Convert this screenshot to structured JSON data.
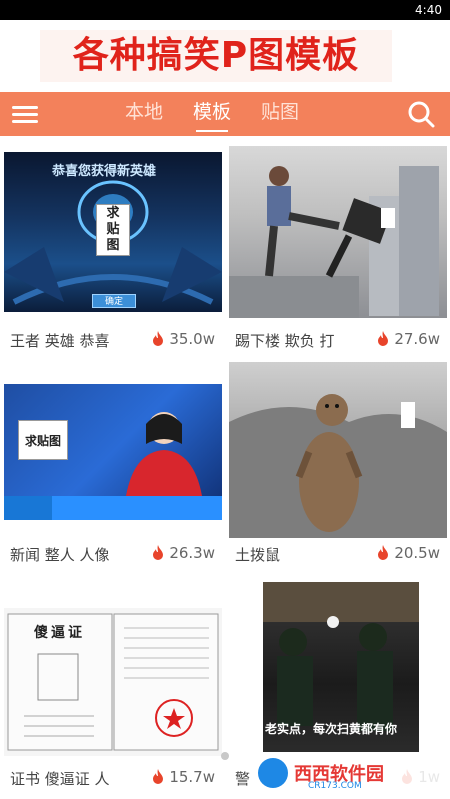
{
  "status_bar": {
    "time": "4:40"
  },
  "banner": {
    "title": "各种搞笑P图模板"
  },
  "navbar": {
    "tabs": [
      "本地",
      "模板",
      "贴图"
    ],
    "active_tab": "模板"
  },
  "templates": [
    {
      "tags": "王者 英雄 恭喜",
      "count": "35.0w",
      "overlay_title": "恭喜您获得新英雄",
      "paste_label": "求\n贴\n图",
      "button_label": "确定"
    },
    {
      "tags": "踢下楼 欺负 打",
      "count": "27.6w"
    },
    {
      "tags": "新闻 整人 人像",
      "count": "26.3w",
      "paste_label": "求贴图"
    },
    {
      "tags": "土拨鼠",
      "count": "20.5w"
    },
    {
      "tags": "证书 傻逼证 人",
      "count": "15.7w",
      "cert_title": "傻逼证"
    },
    {
      "tags": "警",
      "count": "1w",
      "caption": "老实点，每次扫黄都有你"
    }
  ],
  "watermark": {
    "text": "西西软件园",
    "sub": "CR173.COM"
  },
  "colors": {
    "accent": "#f3815b",
    "banner_text": "#e0231b",
    "flame": "#e8442b"
  }
}
